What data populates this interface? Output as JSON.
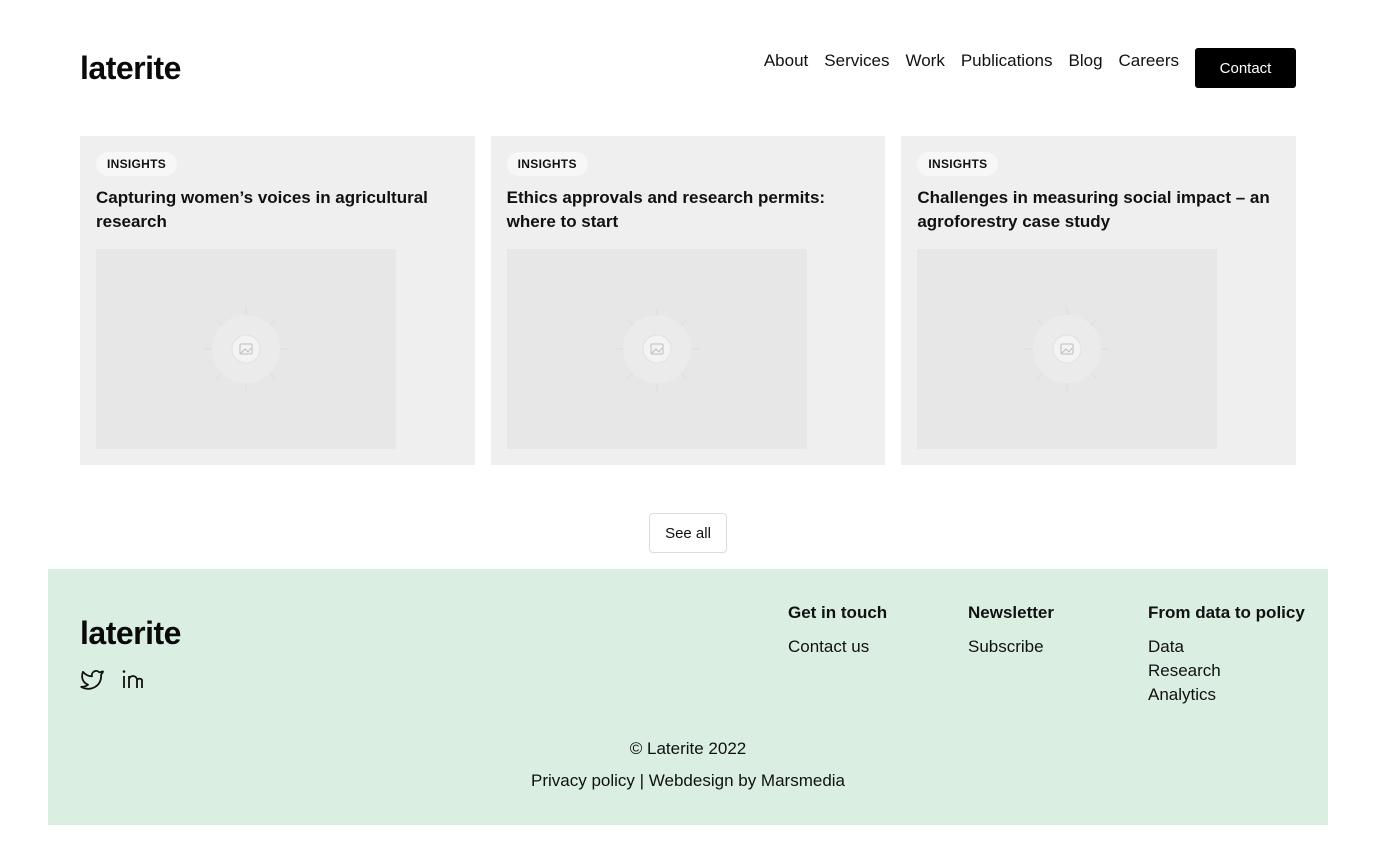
{
  "header": {
    "logo": "laterite",
    "nav": [
      "About",
      "Services",
      "Work",
      "Publications",
      "Blog",
      "Careers"
    ],
    "contact_label": "Contact"
  },
  "cards": [
    {
      "badge": "INSIGHTS",
      "title": "Capturing women’s voices in agricultural research",
      "image_icon": "image-placeholder-icon"
    },
    {
      "badge": "INSIGHTS",
      "title": "Ethics approvals and research permits: where to start",
      "image_icon": "image-placeholder-icon"
    },
    {
      "badge": "INSIGHTS",
      "title": "Challenges in measuring social impact – an agroforestry case study",
      "image_icon": "image-placeholder-icon"
    }
  ],
  "see_all_label": "See all",
  "footer": {
    "logo": "laterite",
    "socials": [
      "twitter-icon",
      "linkedin-icon"
    ],
    "columns": [
      {
        "heading": "Get in touch",
        "links": [
          "Contact us"
        ]
      },
      {
        "heading": "Newsletter",
        "links": [
          "Subscribe"
        ]
      },
      {
        "heading": "From data to policy",
        "links": [
          "Data",
          "Research",
          "Analytics"
        ]
      }
    ],
    "copyright": "© Laterite 2022",
    "privacy": "Privacy policy",
    "separator": " | ",
    "credit": "Webdesign by Marsmedia",
    "background": "#daeee2"
  },
  "colors": {
    "accent": "#000000",
    "card_bg": "#efefef",
    "image_bg": "#e7e7e7"
  }
}
